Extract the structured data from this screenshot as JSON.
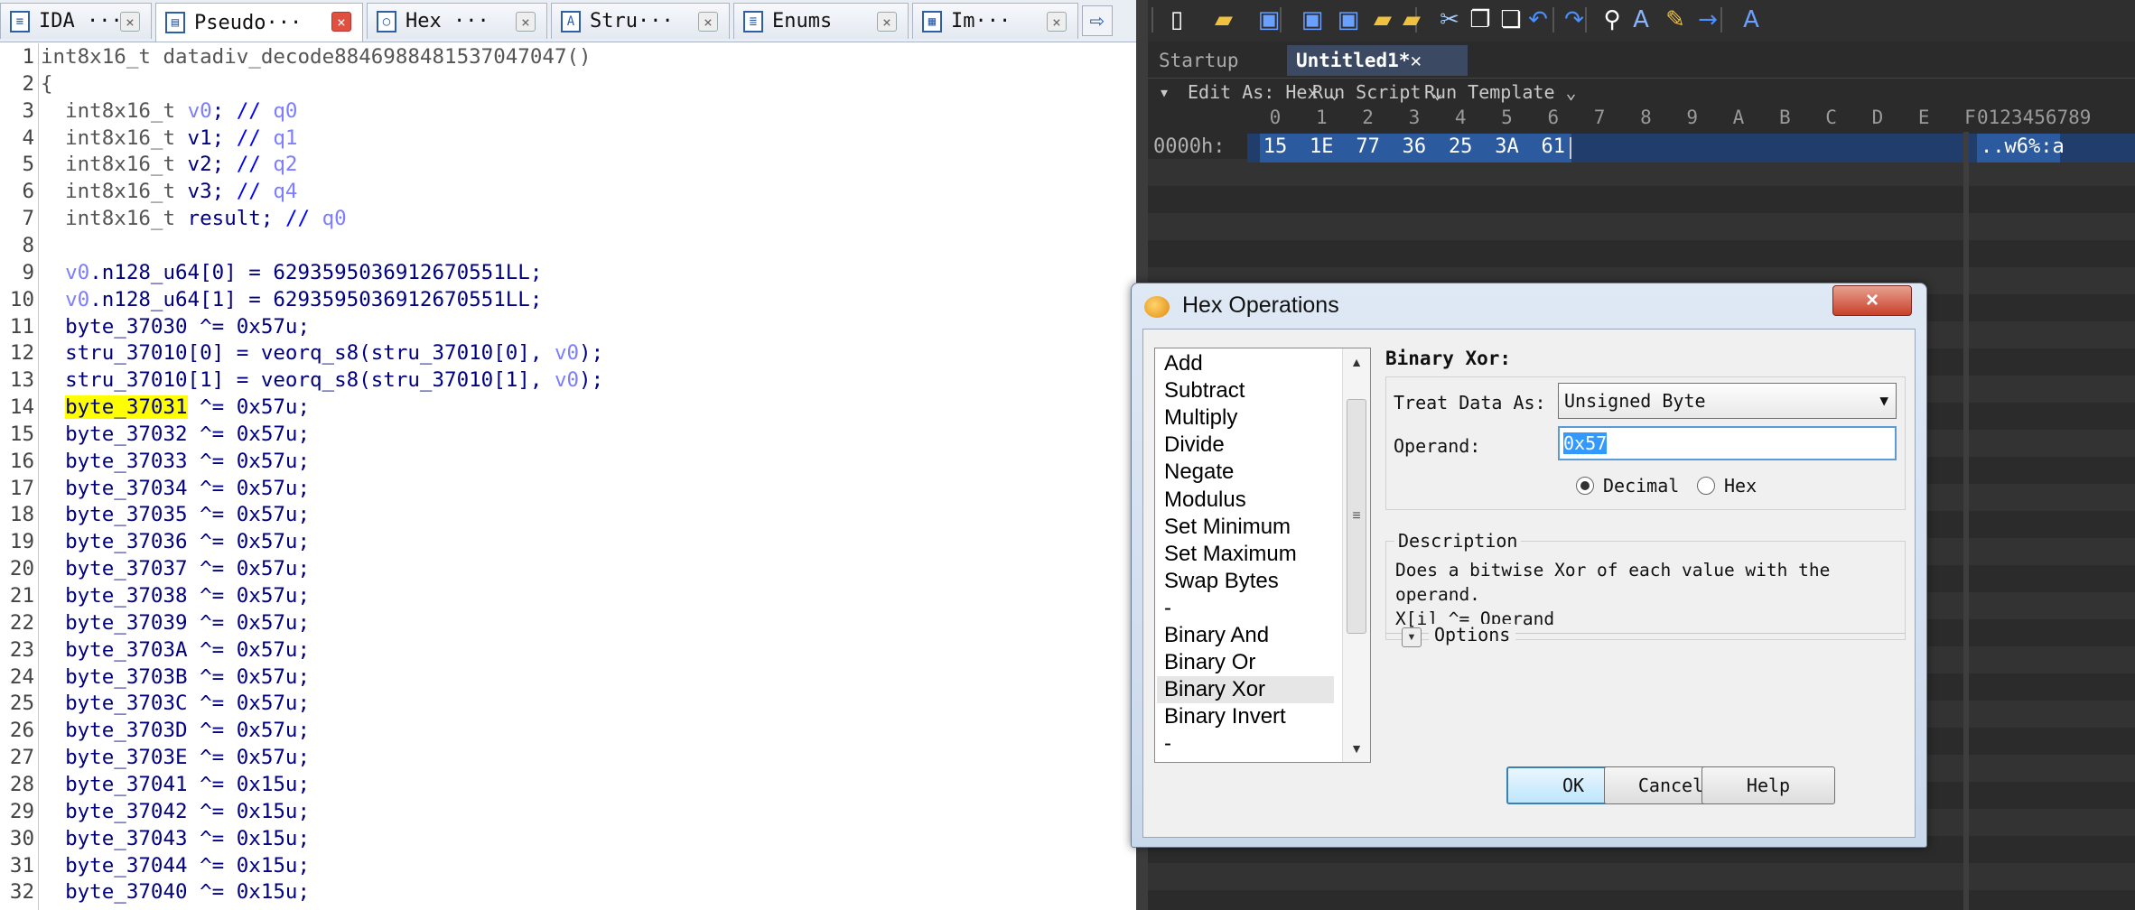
{
  "ida": {
    "tabs": [
      {
        "label": "IDA ···",
        "icon": "document-icon"
      },
      {
        "label": "Pseudo···",
        "icon": "pseudocode-icon",
        "active": true
      },
      {
        "label": "Hex ···",
        "icon": "hex-view-icon"
      },
      {
        "label": "Stru···",
        "icon": "structures-icon"
      },
      {
        "label": "Enums",
        "icon": "enums-icon"
      },
      {
        "label": "Im···",
        "icon": "imports-icon"
      }
    ],
    "close_glyph": "×",
    "code_lines": [
      "int8x16_t datadiv_decode8846988481537047047()",
      "{",
      "  int8x16_t v0; // q0",
      "  int8x16_t v1; // q1",
      "  int8x16_t v2; // q2",
      "  int8x16_t v3; // q4",
      "  int8x16_t result; // q0",
      "",
      "  v0.n128_u64[0] = 6293595036912670551LL;",
      "  v0.n128_u64[1] = 6293595036912670551LL;",
      "  byte_37030 ^= 0x57u;",
      "  stru_37010[0] = veorq_s8(stru_37010[0], v0);",
      "  stru_37010[1] = veorq_s8(stru_37010[1], v0);",
      "  byte_37031 ^= 0x57u;",
      "  byte_37032 ^= 0x57u;",
      "  byte_37033 ^= 0x57u;",
      "  byte_37034 ^= 0x57u;",
      "  byte_37035 ^= 0x57u;",
      "  byte_37036 ^= 0x57u;",
      "  byte_37037 ^= 0x57u;",
      "  byte_37038 ^= 0x57u;",
      "  byte_37039 ^= 0x57u;",
      "  byte_3703A ^= 0x57u;",
      "  byte_3703B ^= 0x57u;",
      "  byte_3703C ^= 0x57u;",
      "  byte_3703D ^= 0x57u;",
      "  byte_3703E ^= 0x57u;",
      "  byte_37041 ^= 0x15u;",
      "  byte_37042 ^= 0x15u;",
      "  byte_37043 ^= 0x15u;",
      "  byte_37044 ^= 0x15u;",
      "  byte_37040 ^= 0x15u;"
    ],
    "highlight_token": "byte_37031"
  },
  "editor": {
    "tabs": [
      {
        "label": "Startup",
        "active": false
      },
      {
        "label": "Untitled1*",
        "active": true
      }
    ],
    "options": {
      "edit_as": "Edit As: Hex",
      "run_script": "Run Script",
      "run_template": "Run Template"
    },
    "column_headers": [
      "0",
      "1",
      "2",
      "3",
      "4",
      "5",
      "6",
      "7",
      "8",
      "9",
      "A",
      "B",
      "C",
      "D",
      "E",
      "F"
    ],
    "ascii_header": "0123456789",
    "rows": [
      {
        "address": "0000h:",
        "bytes": [
          "15",
          "1E",
          "77",
          "36",
          "25",
          "3A",
          "61"
        ],
        "ascii": "..w6%:a"
      }
    ],
    "toolbar_icons": [
      "new-file-icon",
      "open-folder-icon",
      "save-icon",
      "save-as-icon",
      "save-all-icon",
      "folder-icon",
      "folders-icon",
      "cut-icon",
      "copy-icon",
      "paste-icon",
      "undo-icon",
      "redo-icon",
      "find-icon",
      "replace-icon",
      "find-in-files-icon",
      "goto-icon",
      "font-icon"
    ]
  },
  "dialog": {
    "title": "Hex Operations",
    "close_glyph": "×",
    "operations": [
      "Add",
      "Subtract",
      "Multiply",
      "Divide",
      "Negate",
      "Modulus",
      "Set Minimum",
      "Set Maximum",
      "Swap Bytes",
      "-",
      "Binary And",
      "Binary Or",
      "Binary Xor",
      "Binary Invert",
      "-"
    ],
    "selected_operation": "Binary Xor",
    "operation_title": "Binary Xor:",
    "treat_label": "Treat Data As:",
    "treat_value": "Unsigned Byte",
    "operand_label": "Operand:",
    "operand_value": "0x57",
    "radio_decimal": "Decimal",
    "radio_hex": "Hex",
    "radio_selected": "Decimal",
    "description_label": "Description",
    "description_lines": [
      "Does a bitwise Xor of each value with the",
      "operand.",
      "X[i] ^= Operand"
    ],
    "options_label": "Options",
    "ok_label": "OK",
    "cancel_label": "Cancel",
    "help_label": "Help"
  }
}
